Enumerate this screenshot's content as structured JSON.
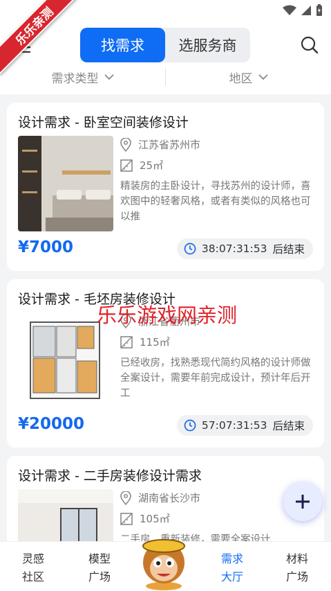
{
  "ribbon": "乐乐亲测",
  "header": {
    "tabs": [
      {
        "label": "找需求",
        "active": true
      },
      {
        "label": "选服务商",
        "active": false
      }
    ],
    "filters": [
      "需求类型",
      "地区"
    ]
  },
  "cards": [
    {
      "title": "设计需求 - 卧室空间装修设计",
      "location": "江苏省苏州市",
      "area": "25㎡",
      "description": "精装房的主卧设计，寻找苏州的设计师，喜欢图中的轻奢风格，或者有类似的风格也可以推",
      "price": "¥7000",
      "countdown": "38:07:31:53",
      "countdown_suffix": "后结束"
    },
    {
      "title": "设计需求 - 毛坯房装修设计",
      "location": "浙江省衢州市",
      "area": "115㎡",
      "description": "已经收房，找熟悉现代简约风格的设计师做全案设计，需要年前完成设计，预计年后开工",
      "price": "¥20000",
      "countdown": "57:07:31:53",
      "countdown_suffix": "后结束"
    },
    {
      "title": "设计需求 - 二手房装修设计需求",
      "location": "湖南省长沙市",
      "area": "105㎡",
      "description": "二手房，重新装修，需要全案设计"
    }
  ],
  "watermark": "乐乐游戏网亲测",
  "tabbar": [
    {
      "line1": "灵感",
      "line2": "社区"
    },
    {
      "line1": "模型",
      "line2": "广场"
    },
    {
      "line1": "需求",
      "line2": "大厅",
      "active": true
    },
    {
      "line1": "材料",
      "line2": "广场"
    }
  ],
  "colors": {
    "accent": "#0f6cf5",
    "price": "#1369f0",
    "ribbon": "#d7262d"
  }
}
